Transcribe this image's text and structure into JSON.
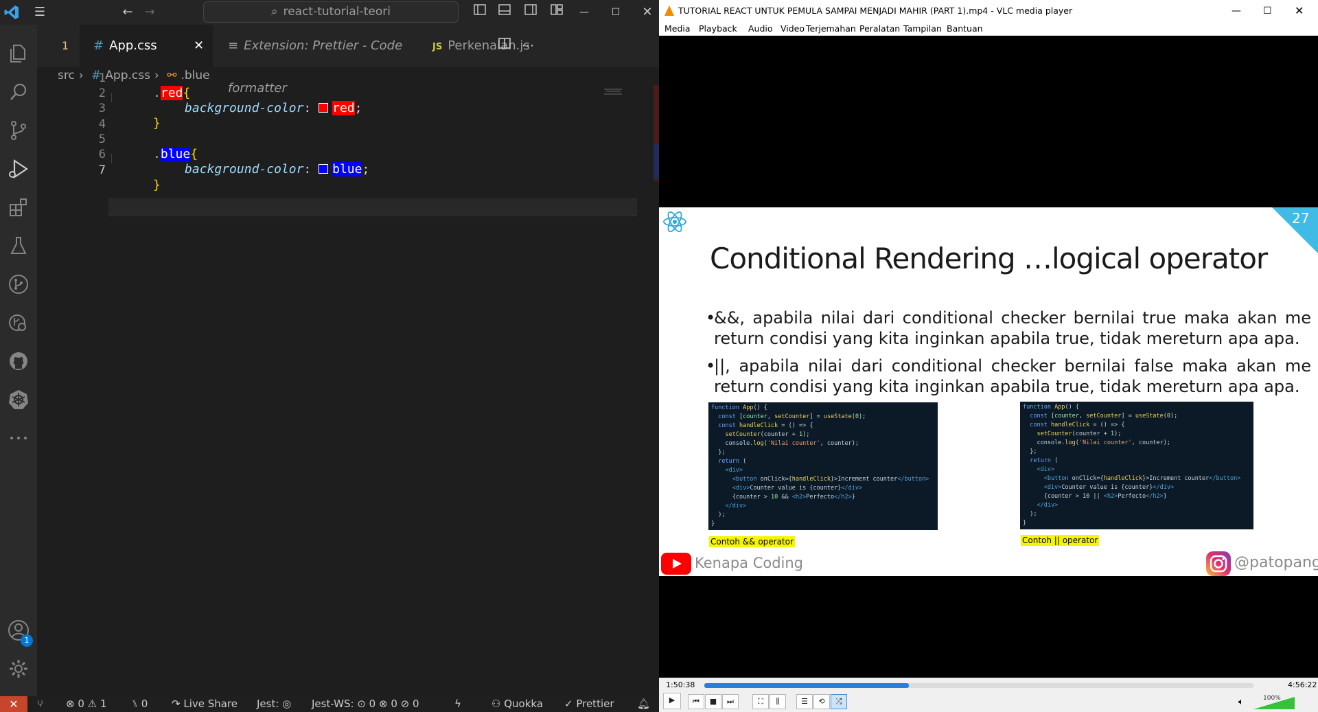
{
  "vscode": {
    "titlebar": {
      "search_text": "react-tutorial-teori"
    },
    "tabs": [
      {
        "label": "1"
      },
      {
        "glyph": "#",
        "label": "App.css",
        "close": "✕"
      },
      {
        "glyph": "≡",
        "label": "Extension: Prettier - Code formatter"
      },
      {
        "glyph": "JS",
        "label": "Perkenalan.js"
      }
    ],
    "breadcrumb": {
      "folder": "src",
      "file_glyph": "#",
      "file": "App.css",
      "symbol": ".blue"
    },
    "line_numbers": [
      "1",
      "2",
      "3",
      "4",
      "5",
      "6",
      "7"
    ],
    "code": {
      "l1_dot": ".",
      "l1_sel": "red",
      "l1_brace": "{",
      "l2_prop": "background-color",
      "l2_colon": ":",
      "l2_val": "red",
      "l2_semi": ";",
      "l3_brace": "}",
      "l5_dot": ".",
      "l5_sel": "blue",
      "l5_brace": "{",
      "l6_prop": "background-color",
      "l6_colon": ":",
      "l6_val": "blue",
      "l6_semi": ";",
      "l7_brace": "}"
    },
    "activity_badge": "1",
    "statusbar": {
      "problems": "⊗ 0 ⚠ 1",
      "ports": "⑊ 0",
      "live_share": "Live Share",
      "jest": "Jest: ◎",
      "jest_ws": "Jest-WS: ⊙ 0 ⊗ 0 ⊘ 0",
      "quokka": "Quokka",
      "prettier": "✓ Prettier"
    }
  },
  "vlc": {
    "title": "TUTORIAL REACT UNTUK PEMULA SAMPAI MENJADI MAHIR (PART 1).mp4 - VLC media player",
    "menu": [
      "Media",
      "Playback",
      "Audio",
      "Video",
      "Terjemahan",
      "Peralatan",
      "Tampilan",
      "Bantuan"
    ],
    "slide": {
      "number": "27",
      "title": "Conditional Rendering …logical operator",
      "bullets": [
        "&&, apabila nilai dari conditional checker bernilai true maka akan me return condisi yang kita inginkan apabila true, tidak mereturn apa apa.",
        "||, apabila nilai dari conditional checker bernilai false maka akan me return condisi yang kita inginkan apabila true, tidak mereturn apa apa."
      ],
      "caption_and": "Contoh && operator",
      "caption_or": "Contoh || operator",
      "channel": "Kenapa Coding",
      "instagram": "@patopangg"
    },
    "elapsed": "1:50:38",
    "total": "4:56:22",
    "progress_fraction": 0.373,
    "volume": "100%"
  }
}
